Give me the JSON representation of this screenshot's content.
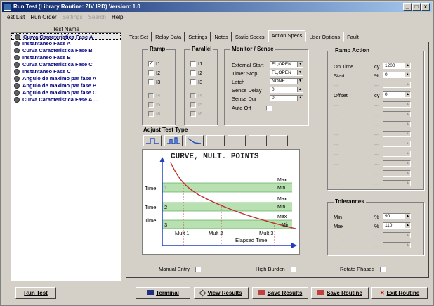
{
  "window": {
    "title": "Run Test (Library Routine: ZIV IRD)  Version: 1.0",
    "minimize": "_",
    "maximize": "□",
    "close": "x"
  },
  "menu": {
    "test_list": "Test List",
    "run_order": "Run Order",
    "settings": "Settings",
    "search": "Search",
    "help": "Help"
  },
  "tree": {
    "header": "Test Name",
    "items": [
      "Curva Caracteristica Fase A",
      "Instantaneo Fase A",
      "Curva Caracteristica Fase B",
      "Instantaneo Fase B",
      "Curva Caracteristica Fase C",
      "Instantaneo Fase C",
      "Angulo de maximo par fase A",
      "Angulo de maximo par fase B",
      "Angulo de maximo par fase C",
      "Curva Caracteristica Fase A ..."
    ]
  },
  "tabs": [
    "Test Set",
    "Relay Data",
    "Settings",
    "Notes",
    "Static Specs",
    "Action Specs",
    "User Options",
    "Fault"
  ],
  "active_tab": "Action Specs",
  "ramp": {
    "title": "Ramp",
    "items": [
      {
        "label": "I1",
        "checked": "✓"
      },
      {
        "label": "I2",
        "checked": ""
      },
      {
        "label": "I3",
        "checked": ""
      },
      {
        "label": "I4",
        "checked": ""
      },
      {
        "label": "I5",
        "checked": ""
      },
      {
        "label": "I6",
        "checked": ""
      }
    ]
  },
  "parallel": {
    "title": "Parallel",
    "items": [
      "I1",
      "I2",
      "I3",
      "I4",
      "I5",
      "I6"
    ]
  },
  "monitor": {
    "title": "Monitor / Sense",
    "external_start": "External Start",
    "external_start_val": "FL,OPEN",
    "timer_stop": "Timer Stop",
    "timer_stop_val": "FL,OPEN",
    "latch": "Latch",
    "latch_val": "NONE",
    "sense_delay": "Sense Delay",
    "sense_delay_val": "0",
    "sense_dur": "Sense Dur",
    "sense_dur_val": "0",
    "auto_off": "Auto Off"
  },
  "adjust": {
    "title": "Adjust Test Type"
  },
  "curve": {
    "title": "CURVE, MULT. POINTS",
    "time": "Time",
    "n1": "1",
    "n2": "2",
    "n3": "3",
    "max": "Max",
    "min": "Min",
    "mult1": "Mult 1",
    "mult2": "Mult 2",
    "mult3": "Mult 3",
    "elapsed": "Elapsed Time"
  },
  "ramp_action": {
    "title": "Ramp Action",
    "on_time": "On Time",
    "on_time_unit": "cy",
    "on_time_val": "1200",
    "start": "Start",
    "start_unit": "%",
    "start_val": "0",
    "dash": "---",
    "offset": "Offset",
    "offset_unit": "cy",
    "offset_val": "0"
  },
  "tolerances": {
    "title": "Tolerances",
    "min": "Min",
    "min_unit": "%",
    "min_val": "90",
    "max": "Max",
    "max_unit": "%",
    "max_val": "110",
    "dash": "---"
  },
  "options": {
    "manual_entry": "Manual Entry",
    "high_burden": "High Burden",
    "rotate_phases": "Rotate Phases"
  },
  "buttons": {
    "run_test": "Run Test",
    "terminal": "Terminal",
    "view_results": "View Results",
    "save_results": "Save Results",
    "save_routine": "Save Routine",
    "exit_routine": "Exit Routine"
  }
}
